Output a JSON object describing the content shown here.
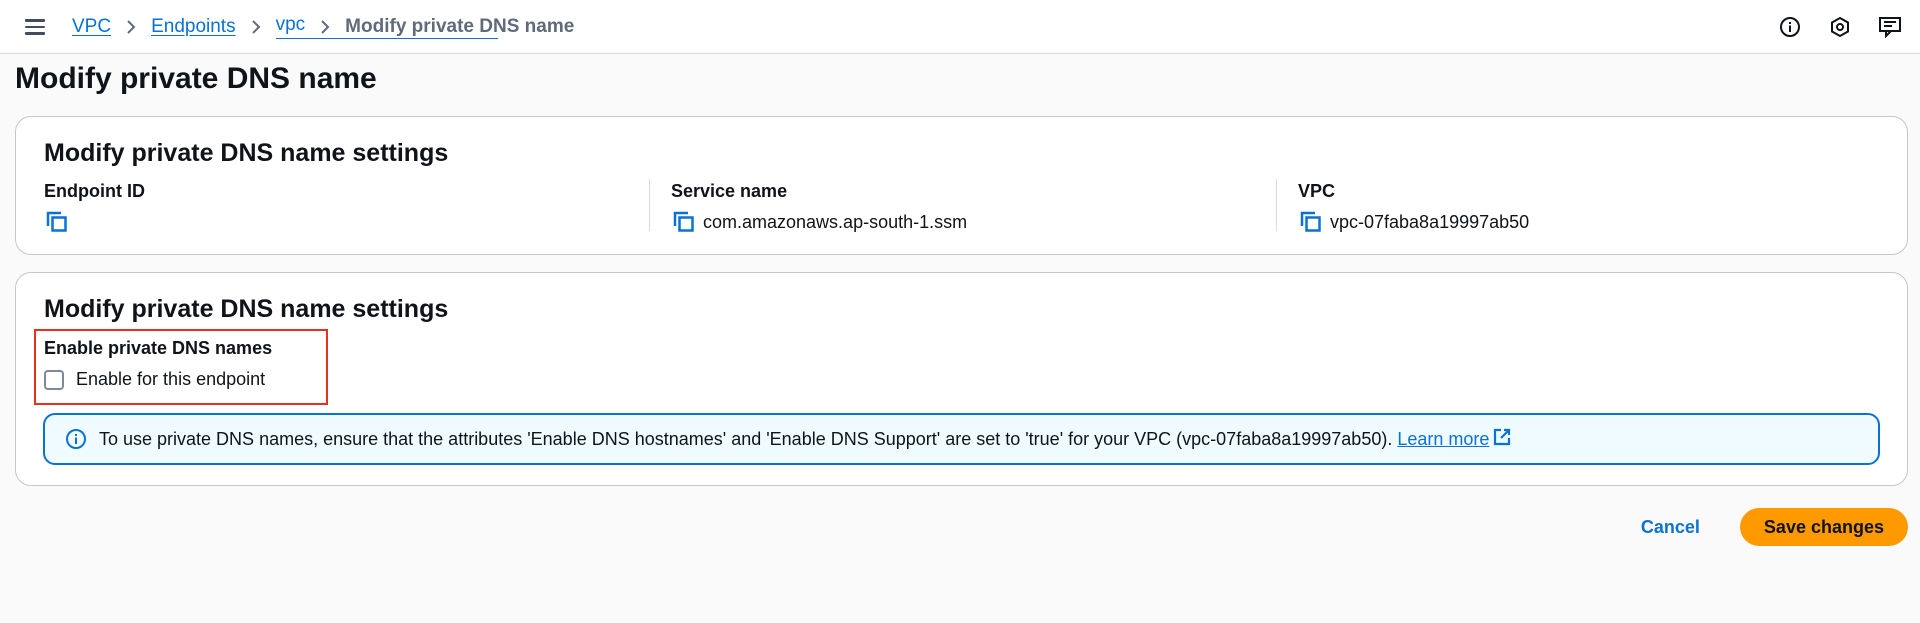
{
  "breadcrumb": {
    "items": [
      "VPC",
      "Endpoints",
      "vpc"
    ],
    "current": "Modify private DNS name"
  },
  "page": {
    "title": "Modify private DNS name"
  },
  "details_card": {
    "title": "Modify private DNS name settings",
    "endpoint_id": {
      "label": "Endpoint ID",
      "value": ""
    },
    "service_name": {
      "label": "Service name",
      "value": "com.amazonaws.ap-south-1.ssm"
    },
    "vpc": {
      "label": "VPC",
      "value": "vpc-07faba8a19997ab50"
    }
  },
  "settings_card": {
    "title": "Modify private DNS name settings",
    "field_label": "Enable private DNS names",
    "checkbox_label": "Enable for this endpoint",
    "checkbox_checked": false,
    "alert_text": "To use private DNS names, ensure that the attributes 'Enable DNS hostnames' and 'Enable DNS Support' are set to 'true' for your VPC (vpc-07faba8a19997ab50).",
    "alert_link": "Learn more"
  },
  "actions": {
    "cancel": "Cancel",
    "save": "Save changes"
  },
  "colors": {
    "link": "#0972d3",
    "primary": "#ff9900",
    "highlight": "#e5311e"
  },
  "icons": [
    "menu-icon",
    "chevron-right-icon",
    "info-icon",
    "shield-settings-icon",
    "feedback-icon",
    "copy-icon",
    "external-link-icon"
  ]
}
